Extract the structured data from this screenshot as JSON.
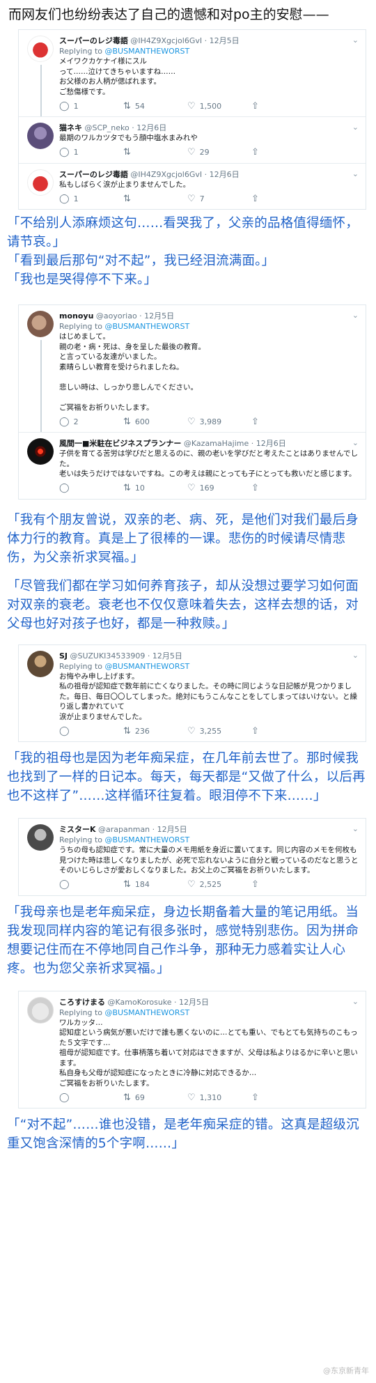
{
  "intro": "而网友们也纷纷表达了自己的遗憾和对po主的安慰——",
  "group1": {
    "tweets": [
      {
        "name": "スーパーのレジ毒語",
        "handle": "@IH4Z9Xgcjol6GvI · 12月5日",
        "reply_prefix": "Replying to ",
        "reply_to": "@BUSMANTHEWORST",
        "body": "メイワクカケナイ様にスル\nって……泣けてきちゃいますね……\nお父様のお人柄が偲ばれます。\nご愁傷様です。",
        "replies": "1",
        "retweets": "54",
        "likes": "1,500"
      },
      {
        "name": "猫ネキ",
        "handle": "@SCP_neko · 12月6日",
        "body": "最期のワルカツタでもう顔中塩水まみれや",
        "replies": "1",
        "retweets": "",
        "likes": "29"
      },
      {
        "name": "スーパーのレジ毒語",
        "handle": "@IH4Z9Xgcjol6GvI · 12月6日",
        "body": "私もしばらく涙が止まりませんでした。",
        "replies": "1",
        "retweets": "",
        "likes": "7"
      }
    ],
    "caption": "「不给别人添麻烦这句……看哭我了，父亲的品格值得缅怀，请节哀。」\n「看到最后那句“对不起”，我已经泪流满面。」\n「我也是哭得停不下来。」"
  },
  "group2": {
    "tweets": [
      {
        "name": "monoyu",
        "handle": "@aoyoriao · 12月5日",
        "reply_prefix": "Replying to ",
        "reply_to": "@BUSMANTHEWORST",
        "body": "はじめまして。\n親の老・病・死は、身を呈した最後の教育。\nと言っている友達がいました。\n素晴らしい教育を受けられましたね。\n\n悲しい時は、しっかり悲しんでください。\n\nご冥福をお祈りいたします。",
        "replies": "2",
        "retweets": "600",
        "likes": "3,989"
      },
      {
        "name": "風間一■米駐在ビジネスプランナー",
        "handle": "@KazamaHajime · 12月6日",
        "body": "子供を育てる苦労は学びだと思えるのに、親の老いを学びだと考えたことはありませんでした。\n老いは失うだけではないですね。この考えは親にとっても子にとっても救いだと感じます。",
        "replies": "",
        "retweets": "10",
        "likes": "169"
      }
    ],
    "caption1": "「我有个朋友曾说，双亲的老、病、死，是他们对我们最后身体力行的教育。真是上了很棒的一课。悲伤的时候请尽情悲伤，为父亲祈求冥福。」",
    "caption2": "「尽管我们都在学习如何养育孩子，却从没想过要学习如何面对双亲的衰老。衰老也不仅仅意味着失去，这样去想的话，对父母也好对孩子也好，都是一种救赎。」"
  },
  "group3": {
    "tweet": {
      "name": "SJ",
      "handle": "@SUZUKI34533909 · 12月5日",
      "reply_prefix": "Replying to ",
      "reply_to": "@BUSMANTHEWORST",
      "body": "お悔やみ申し上げます。\n私の祖母が認知症で数年前に亡くなりました。その時に同じような日記帳が見つかりました。毎日、毎日〇〇してしまった。絶対にもうこんなことをしてしまってはいけない。と繰り返し書かれていて\n涙が止まりませんでした。",
      "replies": "",
      "retweets": "236",
      "likes": "3,255"
    },
    "caption": "「我的祖母也是因为老年痴呆症，在几年前去世了。那时候我也找到了一样的日记本。每天，每天都是“又做了什么，以后再也不这样了”……这样循环往复着。眼泪停不下来……」"
  },
  "group4": {
    "tweet": {
      "name": "ミスターK",
      "handle": "@arapanman · 12月5日",
      "reply_prefix": "Replying to ",
      "reply_to": "@BUSMANTHEWORST",
      "body": "うちの母も認知症です。常に大量のメモ用紙を身近に置いてます。同じ内容のメモを何枚も見つけた時は悲しくなりましたが、必死で忘れないように自分と戦っているのだなと思うとそのいじらしさが愛おしくなりました。お父上のご冥福をお祈りいたします。",
      "replies": "",
      "retweets": "184",
      "likes": "2,525"
    },
    "caption": "「我母亲也是老年痴呆症，身边长期备着大量的笔记用纸。当我发现同样内容的笔记有很多张时，感觉特别悲伤。因为拼命想要记住而在不停地同自己作斗争，那种无力感着实让人心疼。也为您父亲祈求冥福。」"
  },
  "group5": {
    "tweet": {
      "name": "ころすけまる",
      "handle": "@KamoKorosuke · 12月5日",
      "reply_prefix": "Replying to ",
      "reply_to": "@BUSMANTHEWORST",
      "body": "ワルカッタ…\n認知症という病気が悪いだけで誰も悪くないのに…とても重い、でもとても気持ちのこもった５文字です…\n祖母が認知症です。仕事柄落ち着いて対応はできますが、父母は私よりはるかに辛いと思います。\n私自身も父母が認知症になったときに冷静に対応できるか…\nご冥福をお祈りいたします。",
      "replies": "",
      "retweets": "69",
      "likes": "1,310"
    },
    "caption": "「“对不起”……谁也没错，是老年痴呆症的错。这真是超级沉重又饱含深情的5个字啊……」"
  },
  "watermark": "@东京新青年",
  "colors": {
    "caption": "#1f62c9",
    "link": "#1b95e0",
    "muted": "#657786",
    "border": "#e1e8ed"
  },
  "icons": {
    "reply": "reply-icon",
    "retweet": "retweet-icon",
    "like": "heart-icon",
    "share": "share-icon",
    "menu": "chevron-down-icon"
  }
}
